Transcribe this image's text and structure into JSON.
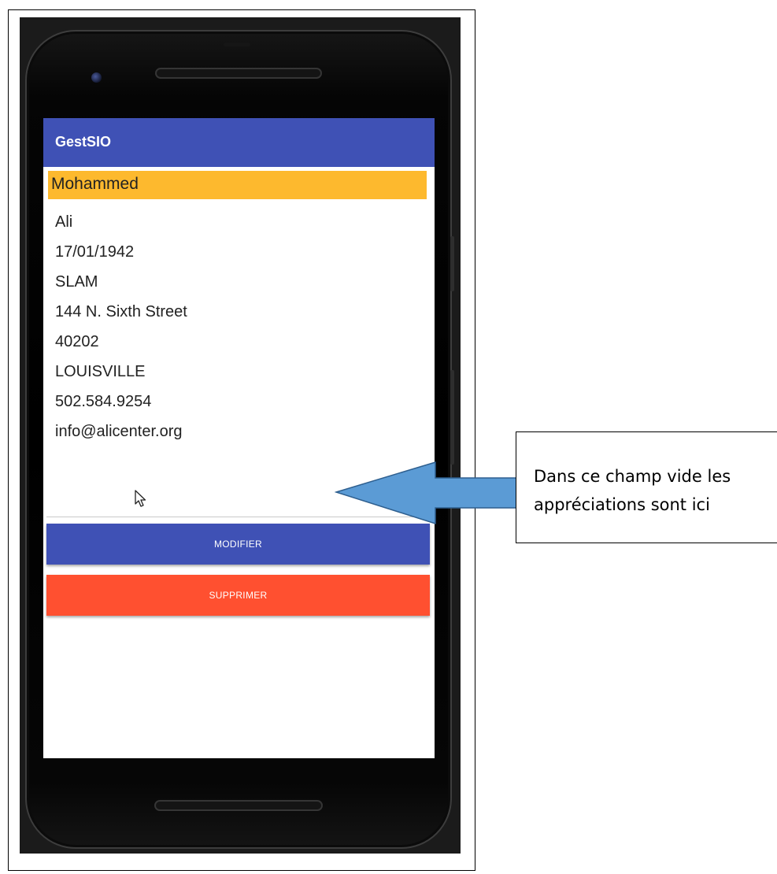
{
  "app": {
    "title": "GestSIO"
  },
  "student": {
    "nom": "Mohammed",
    "prenom": "Ali",
    "date_naissance": "17/01/1942",
    "option": "SLAM",
    "adresse": "144 N. Sixth Street",
    "code_postal": "40202",
    "ville": "LOUISVILLE",
    "telephone": "502.584.9254",
    "email": "info@alicenter.org",
    "appreciations": ""
  },
  "buttons": {
    "modifier": "MODIFIER",
    "supprimer": "SUPPRIMER"
  },
  "annotation": {
    "line1": "Dans ce champ vide les",
    "line2": "appréciations sont ici",
    "arrow_color": "#5b9bd5"
  },
  "colors": {
    "app_bar": "#3f51b5",
    "name_highlight": "#fdb92e",
    "modifier_button": "#3f51b5",
    "supprimer_button": "#ff5030"
  },
  "icons": {
    "cursor": "mouse-pointer-icon",
    "camera": "front-camera-icon"
  }
}
